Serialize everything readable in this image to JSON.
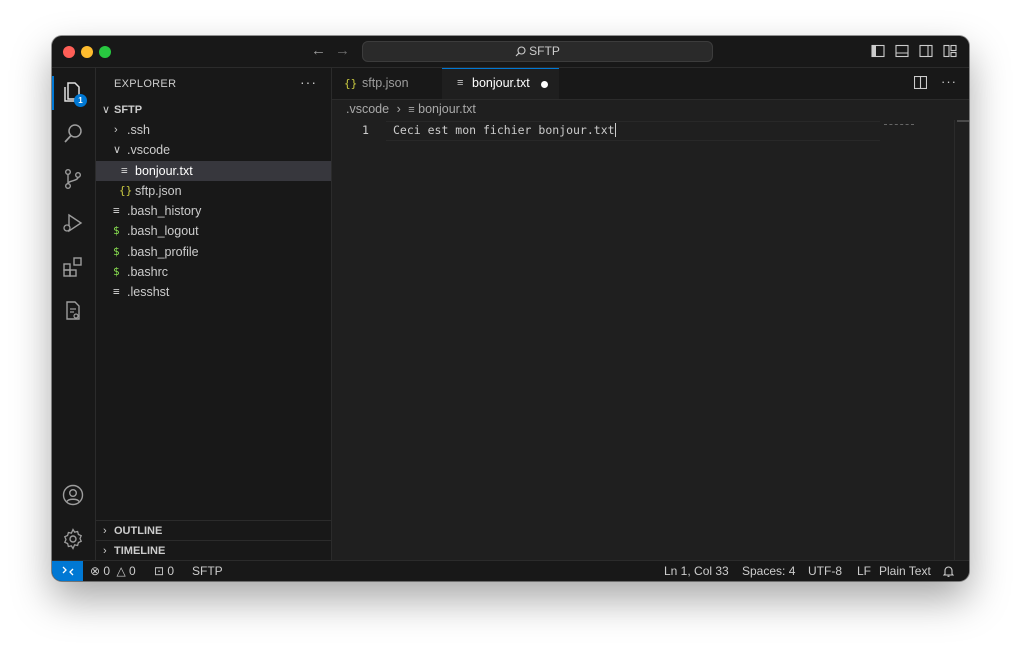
{
  "titlebar": {
    "search_label": "SFTP"
  },
  "activity": {
    "explorer_badge": "1"
  },
  "sidebar": {
    "header": "EXPLORER",
    "more": "···",
    "root": "SFTP",
    "items": [
      {
        "label": ".ssh",
        "type": "folder",
        "expanded": false
      },
      {
        "label": ".vscode",
        "type": "folder",
        "expanded": true
      },
      {
        "label": "bonjour.txt",
        "type": "text",
        "selected": true
      },
      {
        "label": "sftp.json",
        "type": "json"
      },
      {
        "label": ".bash_history",
        "type": "text"
      },
      {
        "label": ".bash_logout",
        "type": "shell"
      },
      {
        "label": ".bash_profile",
        "type": "shell"
      },
      {
        "label": ".bashrc",
        "type": "shell"
      },
      {
        "label": ".lesshst",
        "type": "text"
      }
    ],
    "outline": "OUTLINE",
    "timeline": "TIMELINE"
  },
  "tabs": [
    {
      "label": "sftp.json",
      "icon": "json-icon",
      "active": false
    },
    {
      "label": "bonjour.txt",
      "icon": "text-file-icon",
      "active": true,
      "dirty": true
    }
  ],
  "breadcrumb": {
    "folder": ".vscode",
    "file": "bonjour.txt"
  },
  "editor": {
    "line_number": "1",
    "content": "Ceci est mon fichier bonjour.txt"
  },
  "statusbar": {
    "errors": "0",
    "warnings": "0",
    "ports": "0",
    "remote_name": "SFTP",
    "position": "Ln 1, Col 33",
    "spaces": "Spaces: 4",
    "encoding": "UTF-8",
    "eol": "LF",
    "language": "Plain Text"
  },
  "colors": {
    "accent": "#0078d4",
    "json_icon": "#cbcb41",
    "shell_icon": "#89e051"
  }
}
